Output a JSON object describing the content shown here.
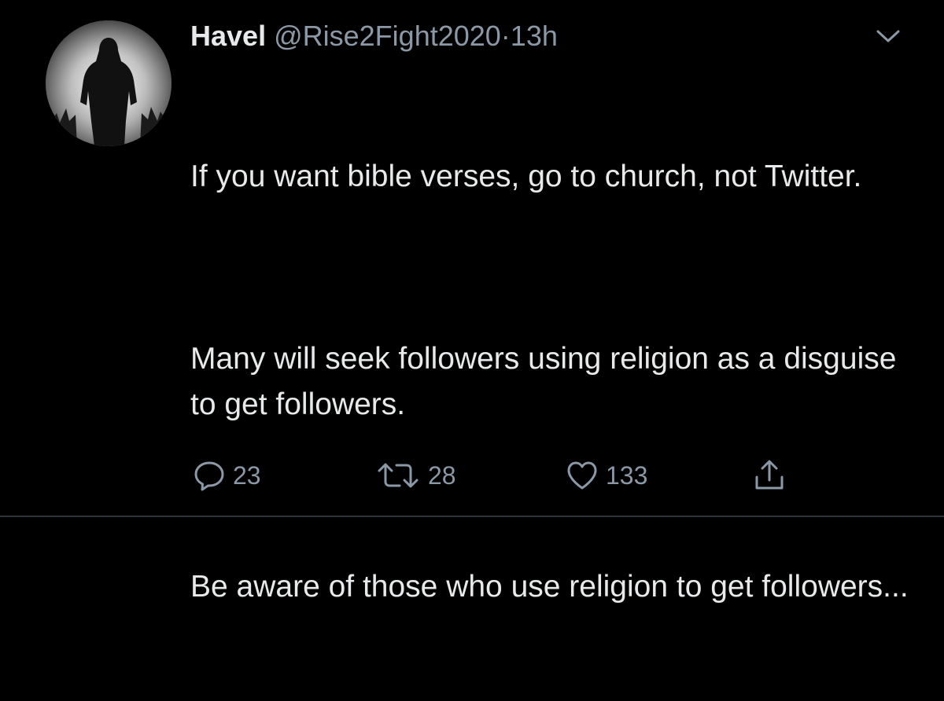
{
  "tweet": {
    "author_name": "Havel",
    "handle": "@Rise2Fight2020",
    "separator": "·",
    "time": "13h",
    "paragraphs": [
      "If you want bible verses, go to church, not Twitter.",
      "Many will seek followers using religion as a disguise to get followers.",
      "Be aware of those who use religion to get followers..."
    ],
    "actions": {
      "reply_count": "23",
      "retweet_count": "28",
      "like_count": "133"
    }
  },
  "icons": {
    "menu": "chevron-down-icon",
    "reply": "reply-icon",
    "retweet": "retweet-icon",
    "like": "heart-icon",
    "share": "share-icon"
  },
  "colors": {
    "background": "#000000",
    "text": "#e7e9ea",
    "secondary": "#8b98a5"
  }
}
